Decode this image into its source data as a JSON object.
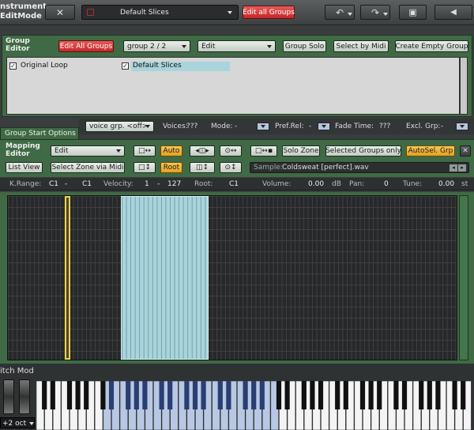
{
  "topbar": {
    "title_line1": "nstrument",
    "title_line2": "EditMode",
    "close_glyph": "✕",
    "group_display": "Default Slices",
    "edit_all_groups": "Edit all Groups"
  },
  "group_editor": {
    "title_line1": "Group",
    "title_line2": "Editor",
    "edit_all_groups": "Edit All Groups",
    "group_select": "group 2 / 2",
    "edit_select": "Edit",
    "group_solo": "Group Solo",
    "select_by_midi": "Select by Midi",
    "create_empty_group": "Create Empty Group",
    "groups": [
      {
        "name": "Original Loop",
        "checked": true
      },
      {
        "name": "Default Slices",
        "checked": true,
        "selected": true
      }
    ]
  },
  "group_start": {
    "tab_label": "Group Start Options",
    "voice_group": "voice grp. <off>",
    "voices_label": "Voices:",
    "voices_value": "???",
    "mode_label": "Mode:",
    "mode_value": "-",
    "pref_rel_label": "Pref.Rel:",
    "pref_rel_value": "-",
    "fade_time_label": "Fade Time:",
    "fade_time_value": "???",
    "excl_grp_label": "Excl. Grp:",
    "excl_grp_value": "-"
  },
  "mapping_editor": {
    "title_line1": "Mapping",
    "title_line2": "Editor",
    "edit_select": "Edit",
    "list_view": "List View",
    "select_zone_via_midi": "Select Zone via Midi",
    "auto": "Auto",
    "root": "Root",
    "solo_zone": "Solo Zone",
    "selected_groups_only": "Selected Groups only",
    "autosel_grp": "AutoSel. Grp",
    "close": "✕",
    "sample_label": "Sample:",
    "sample_value": "Coldsweat [perfect].wav"
  },
  "info_bar": {
    "krange_label": "K.Range:",
    "krange_low": "C1",
    "krange_dash": "-",
    "krange_high": "C1",
    "velocity_label": "Velocity:",
    "velocity_low": "1",
    "velocity_dash": "-",
    "velocity_high": "127",
    "root_label": "Root:",
    "root_value": "C1",
    "volume_label": "Volume:",
    "volume_value": "0.00",
    "volume_unit": "dB",
    "pan_label": "Pan:",
    "pan_value": "0",
    "tune_label": "Tune:",
    "tune_value": "0.00",
    "tune_unit": "st"
  },
  "keyboard": {
    "pitch_mod_label": "itch Mod",
    "octave_value": "+2 oct"
  },
  "colors": {
    "green_panel": "#3f6a45",
    "selected_zone": "#a9d4dc",
    "active_zone": "#f0d24a",
    "red_button": "#d23a3a",
    "orange_button": "#f0b23a"
  }
}
